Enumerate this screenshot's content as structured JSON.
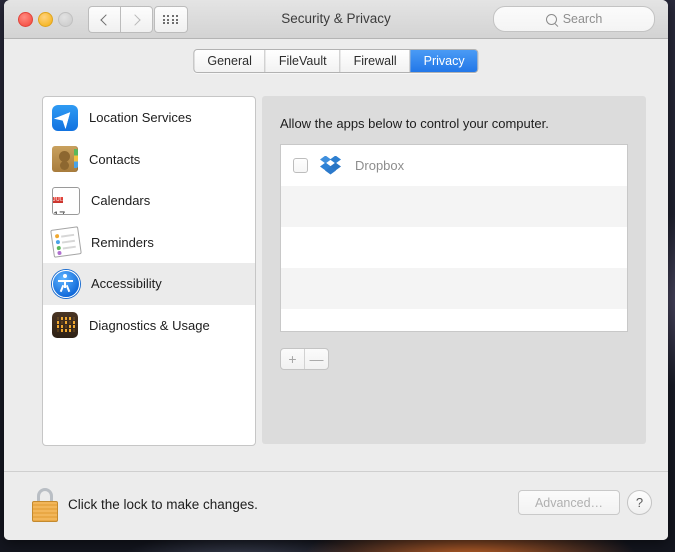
{
  "window": {
    "title": "Security & Privacy",
    "traffic_lights": [
      "close",
      "minimize",
      "zoom"
    ],
    "nav": {
      "back": "back-chevron",
      "forward": "forward-chevron",
      "grid": "show-all-grid"
    },
    "search": {
      "placeholder": "Search",
      "value": "",
      "icon": "search-icon"
    }
  },
  "tabs": [
    {
      "label": "General",
      "selected": false
    },
    {
      "label": "FileVault",
      "selected": false
    },
    {
      "label": "Firewall",
      "selected": false
    },
    {
      "label": "Privacy",
      "selected": true
    }
  ],
  "sidebar": {
    "items": [
      {
        "label": "Location Services",
        "icon": "location-services-icon",
        "selected": false
      },
      {
        "label": "Contacts",
        "icon": "contacts-icon",
        "selected": false
      },
      {
        "label": "Calendars",
        "icon": "calendars-icon",
        "selected": false
      },
      {
        "label": "Reminders",
        "icon": "reminders-icon",
        "selected": false
      },
      {
        "label": "Accessibility",
        "icon": "accessibility-icon",
        "selected": true
      },
      {
        "label": "Diagnostics & Usage",
        "icon": "diagnostics-icon",
        "selected": false
      }
    ],
    "calendar_icon": {
      "month": "JUL",
      "day": "17"
    }
  },
  "panel": {
    "caption": "Allow the apps below to control your computer.",
    "apps": [
      {
        "name": "Dropbox",
        "checked": false,
        "icon": "dropbox-icon"
      }
    ],
    "empty_row_count": 4,
    "add_button": "+",
    "remove_button": "—"
  },
  "footer": {
    "lock_icon": "lock-closed-icon",
    "lock_caption": "Click the lock to make changes.",
    "advanced_label": "Advanced…",
    "help_label": "?"
  },
  "colors": {
    "accent": "#2277e8",
    "window_bg": "#ececec",
    "panel_bg": "#dcdcdc",
    "list_bg": "#ffffff",
    "stripe": "#f4f4f4",
    "lock_gold": "#e9a845"
  }
}
